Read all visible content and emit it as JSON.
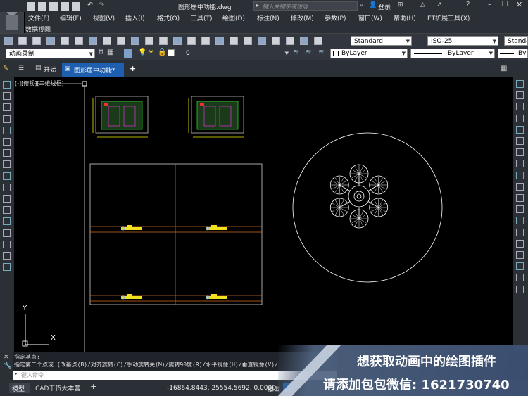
{
  "app": {
    "file_title": "图形居中功能.dwg",
    "search_placeholder": "键入关键字或短语",
    "login_label": "登录"
  },
  "menu": [
    "文件(F)",
    "编辑(E)",
    "视图(V)",
    "插入(I)",
    "格式(O)",
    "工具(T)",
    "绘图(D)",
    "标注(N)",
    "修改(M)",
    "参数(P)",
    "窗口(W)",
    "帮助(H)",
    "ET扩展工具(X)"
  ],
  "menu_row2": "数据视图",
  "toolbar": {
    "text_style": "Standard",
    "dim_style": "ISO-25",
    "table_style": "Standa",
    "workspace": "动画录制",
    "layer": "0",
    "color": "ByLayer",
    "linetype": "ByLayer",
    "lineweight": "By"
  },
  "tabs": {
    "start": "开始",
    "drawing": "图形居中功能*",
    "add": "+"
  },
  "viewport_label": "[-][俯视][二维线框]",
  "ucs": {
    "y": "Y",
    "x": "X"
  },
  "command": {
    "line1": "指定基点:",
    "line2": "指定第二个点或 [改基点(B)/对齐旋转(C)/手动旋转关(M)/旋转90度(R)/水平镜像(H)/垂直镜像(V)/",
    "input_placeholder": "键入命令"
  },
  "status": {
    "model_tab": "模型",
    "layout_tab": "CAD干货大本营",
    "add_tab": "+",
    "coordinates": "-16864.8443, 25554.5692, 0.0000",
    "model_label": "模型"
  },
  "promo": {
    "line1": "想获取动画中的绘图插件",
    "line2": "请添加包包微信: 1621730740"
  },
  "colors": {
    "canvas": "#000000",
    "ui_dark": "#2b2f36",
    "accent_blue": "#2f6fbf",
    "cad_orange": "#d46a1a",
    "cad_yellow": "#f0e020"
  }
}
